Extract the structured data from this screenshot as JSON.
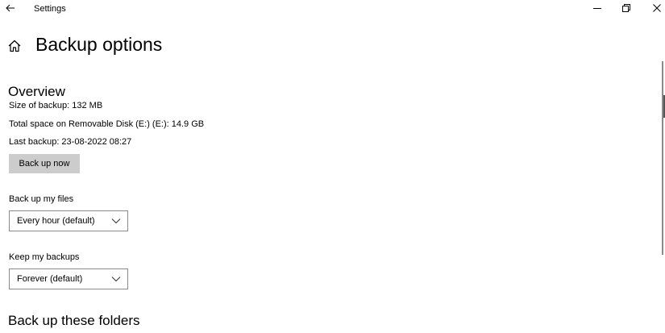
{
  "window": {
    "app_title": "Settings"
  },
  "page": {
    "title": "Backup options"
  },
  "overview": {
    "heading": "Overview",
    "size_of_backup": "Size of backup: 132 MB",
    "total_space": "Total space on Removable Disk (E:) (E:): 14.9 GB",
    "last_backup": "Last backup: 23-08-2022 08:27",
    "backup_now_label": "Back up now"
  },
  "backup_frequency": {
    "label": "Back up my files",
    "selected": "Every hour (default)"
  },
  "retention": {
    "label": "Keep my backups",
    "selected": "Forever (default)"
  },
  "folders": {
    "heading": "Back up these folders"
  },
  "icons": {
    "back": "back-arrow-icon",
    "home": "home-icon",
    "minimize": "minimize-icon",
    "maximize": "restore-icon",
    "close": "close-icon",
    "dropdown": "chevron-down-icon"
  }
}
